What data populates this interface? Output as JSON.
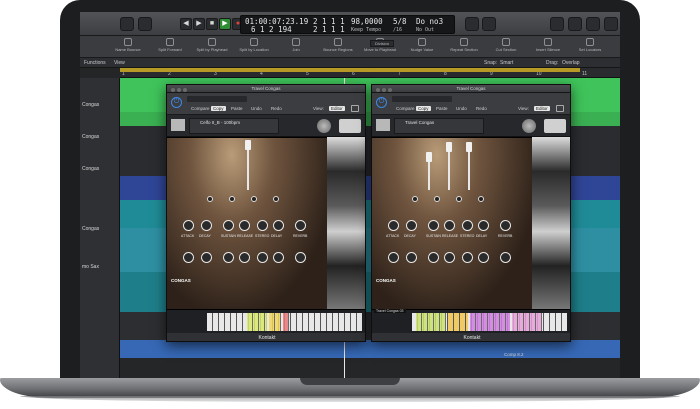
{
  "lcd": {
    "time": "01:00:07:23.19",
    "time_sub": "6 1 2 194",
    "bars": "2 1 1 1",
    "bars_sub": "2 1 1 1",
    "tempo": "98,0000",
    "tempo_sub": "Keep Tempo",
    "signature": "5/8",
    "signature_sub": "/16",
    "key": "Do no3",
    "key_sub": "No Out"
  },
  "toolbar": {
    "tools": [
      "Name Bounce",
      "Split Forward",
      "Split by Playhead",
      "Split by Location",
      "Join",
      "Bounce Regions",
      "Move to Playhead",
      "Nudge Value",
      "Repeat Section",
      "Cut Section",
      "Insert Silence",
      "Set Locators"
    ],
    "division_label": "Division"
  },
  "tracks_bar": {
    "functions": "Functions",
    "view": "View",
    "snap": "Snap:",
    "snap_value": "Smart",
    "drag": "Drag:",
    "drag_value": "Overlap"
  },
  "ruler": [
    "1",
    "2",
    "3",
    "4",
    "5",
    "6",
    "7",
    "8",
    "9",
    "10",
    "11"
  ],
  "tracks": [
    "Congas",
    "Congas",
    "Congas",
    "Congas",
    "mo Sax"
  ],
  "plugins": [
    {
      "title": "Travel Congas",
      "menu": [
        "Compare",
        "Copy",
        "Paste",
        "Undo",
        "Redo"
      ],
      "view": "View:",
      "editor": "Editor",
      "instrument": "Celfo II_B - 100bpm",
      "tab": "",
      "footer": "Kontakt",
      "logo": "CONGAS",
      "labels": [
        "ATTACK",
        "DECAY",
        "SUSTAIN",
        "RELEASE",
        "STEREO",
        "DELAY",
        "REVERB"
      ]
    },
    {
      "title": "Travel Congas",
      "menu": [
        "Compare",
        "Copy",
        "Paste",
        "Undo",
        "Redo"
      ],
      "view": "View:",
      "editor": "Editor",
      "instrument": "Travel Congas",
      "tab": "Travel Congas 03",
      "footer": "Kontakt",
      "logo": "CONGAS",
      "labels": [
        "ATTACK",
        "DECAY",
        "SUSTAIN",
        "RELEASE",
        "STEREO",
        "DELAY",
        "REVERB"
      ]
    }
  ],
  "comp_label": "Comp 8.2",
  "colors": {
    "green": "#3fc35a",
    "blue": "#3668b5",
    "teal": "#1f8b96",
    "navy": "#2f4596",
    "gold": "#b79a26"
  }
}
